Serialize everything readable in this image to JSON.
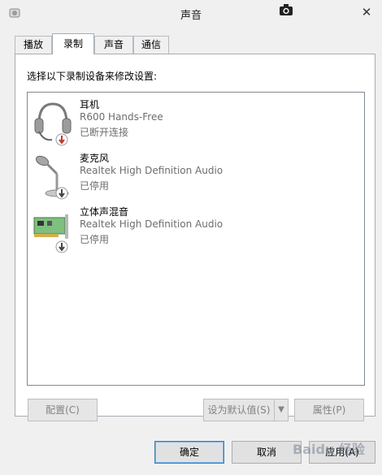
{
  "window": {
    "title": "声音"
  },
  "tabs": [
    {
      "label": "播放",
      "active": false
    },
    {
      "label": "录制",
      "active": true
    },
    {
      "label": "声音",
      "active": false
    },
    {
      "label": "通信",
      "active": false
    }
  ],
  "instruction": "选择以下录制设备来修改设置:",
  "devices": [
    {
      "name": "耳机",
      "description": "R600 Hands-Free",
      "status": "已断开连接",
      "icon": "headset-icon",
      "badge": "disconnected"
    },
    {
      "name": "麦克风",
      "description": "Realtek High Definition Audio",
      "status": "已停用",
      "icon": "microphone-icon",
      "badge": "disabled"
    },
    {
      "name": "立体声混音",
      "description": "Realtek High Definition Audio",
      "status": "已停用",
      "icon": "sound-card-icon",
      "badge": "disabled"
    }
  ],
  "buttons": {
    "configure": "配置(C)",
    "set_default": "设为默认值(S)",
    "properties": "属性(P)",
    "ok": "确定",
    "cancel": "取消",
    "apply": "应用(A)"
  },
  "watermark": "Baidu 经验",
  "colors": {
    "disconnected_badge": "#c0392b",
    "disabled_badge": "#444444",
    "panel_bg": "#ffffff",
    "window_bg": "#f0f0f0"
  }
}
